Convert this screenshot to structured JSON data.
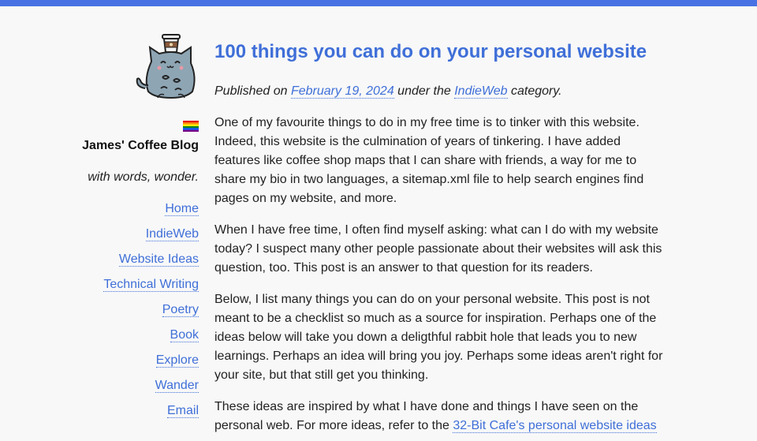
{
  "site": {
    "title": "James' Coffee Blog",
    "tagline": "with words, wonder.",
    "accent_color": "#4872e3",
    "link_color": "#3f6fd8",
    "logo_icon": "cat-with-coffee-cup-icon",
    "flag_icon": "rainbow-flag-icon"
  },
  "nav": [
    {
      "label": "Home"
    },
    {
      "label": "IndieWeb"
    },
    {
      "label": "Website Ideas"
    },
    {
      "label": "Technical Writing"
    },
    {
      "label": "Poetry"
    },
    {
      "label": "Book"
    },
    {
      "label": "Explore"
    },
    {
      "label": "Wander"
    },
    {
      "label": "Email"
    }
  ],
  "post": {
    "title": "100 things you can do on your personal website",
    "meta_prefix": "Published on ",
    "date": "February 19, 2024",
    "meta_mid": " under the ",
    "category": "IndieWeb",
    "meta_suffix": " category.",
    "paragraphs": [
      "One of my favourite things to do in my free time is to tinker with this website. Indeed, this website is the culmination of years of tinkering. I have added features like coffee shop maps that I can share with friends, a way for me to share my bio in two languages, a sitemap.xml file to help search engines find pages on my website, and more.",
      "When I have free time, I often find myself asking: what can I do with my website today? I suspect many other people passionate about their websites will ask this question, too. This post is an answer to that question for its readers.",
      "Below, I list many things you can do on your personal website. This post is not meant to be a checklist so much as a source for inspiration. Perhaps one of the ideas below will take you down a deligthful rabbit hole that leads you to new learnings. Perhaps an idea will bring you joy. Perhaps some ideas aren't right for your site, but that still get you thinking."
    ],
    "last_paragraph_prefix": "These ideas are inspired by what I have done and things I have seen on the personal web. For more ideas, refer to the ",
    "last_paragraph_link": "32-Bit Cafe's personal website ideas"
  }
}
